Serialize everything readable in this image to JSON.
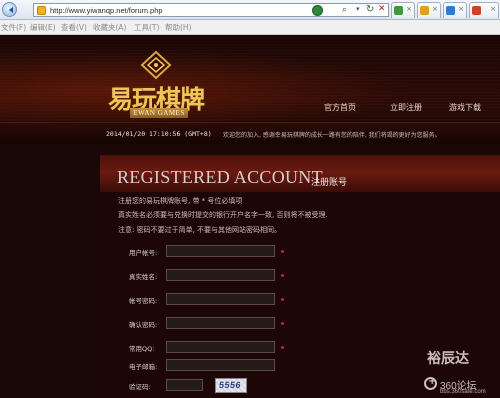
{
  "browser": {
    "url": "http://www.yiwanqp.net/forum.php",
    "menu": [
      "文件(F)",
      "编辑(E)",
      "查看(V)",
      "收藏夹(A)",
      "工具(T)",
      "帮助(H)"
    ],
    "tabs": [
      {
        "icon_color": "#3a9b3a"
      },
      {
        "icon_color": "#e0a21a"
      },
      {
        "icon_color": "#2e7bd6"
      },
      {
        "icon_color": "#d23f2b"
      }
    ]
  },
  "header": {
    "logo_text": "易玩棋牌",
    "logo_subtitle": "EWAN GAMES",
    "nav": [
      "官方首页",
      "立即注册",
      "游戏下载"
    ],
    "datetime": "2014/01/20 17:10:56 (GMT+8)",
    "welcome": "欢迎您的加入, 感谢幸易玩棋牌的成长一路有您的陪伴, 我们将竭的更好为您服务。"
  },
  "register": {
    "title": "REGISTERED ACCOUNT",
    "subtitle": "注册账号",
    "notes": [
      "注册您的易玩棋牌账号, 带 * 号位必填项",
      "真实姓名必须要与兑换时提交的银行开户名字一致, 否则将不被受理.",
      "注意: 密码不要过于简单, 不要与其他网站密码相同。"
    ],
    "fields": [
      {
        "label": "用户帐号:"
      },
      {
        "label": "真实姓名:"
      },
      {
        "label": "帐号密码:"
      },
      {
        "label": "确认密码:"
      },
      {
        "label": "常用QQ:"
      },
      {
        "label": "电子邮箱:"
      }
    ],
    "captcha_label": "验证码:",
    "captcha_code": "5556"
  },
  "watermark": {
    "text": "裕辰达",
    "brand": "360论坛",
    "url": "bbs.360safe.com"
  },
  "colors": {
    "accent_gold": "#f1c45a",
    "required_dot": "#c8231e",
    "panel_bg": "#1c0706"
  }
}
